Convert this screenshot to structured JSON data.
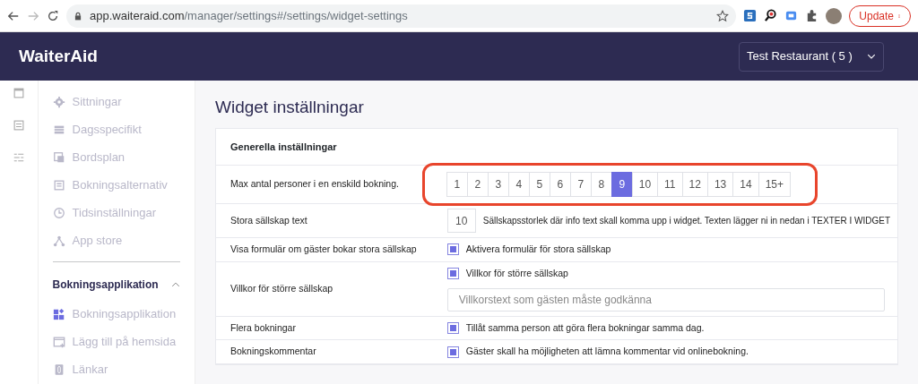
{
  "browser": {
    "url_host": "app.waiteraid.com",
    "url_path": "/manager/settings#/settings/widget-settings",
    "update_label": "Update"
  },
  "header": {
    "logo": "WaiterAid",
    "restaurant": "Test Restaurant ( 5 )"
  },
  "sidebar": {
    "items": [
      {
        "label": "Sittningar",
        "selected": false
      },
      {
        "label": "Dagsspecifikt",
        "selected": false
      },
      {
        "label": "Bordsplan",
        "selected": false
      },
      {
        "label": "Bokningsalternativ",
        "selected": false
      },
      {
        "label": "Tidsinställningar",
        "selected": false
      },
      {
        "label": "App store",
        "selected": false
      }
    ],
    "section": {
      "label": "Bokningsapplikation",
      "expanded": true,
      "items": [
        {
          "label": "Bokningsapplikation",
          "selected": true
        },
        {
          "label": "Lägg till på hemsida",
          "selected": false
        },
        {
          "label": "Länkar",
          "selected": false
        }
      ]
    }
  },
  "page": {
    "title": "Widget inställningar",
    "card_title": "Generella inställningar",
    "rows": [
      {
        "kind": "picker",
        "label": "Max antal personer i en enskild bokning.",
        "options": [
          {
            "label": "1",
            "selected": false
          },
          {
            "label": "2",
            "selected": false
          },
          {
            "label": "3",
            "selected": false
          },
          {
            "label": "4",
            "selected": false
          },
          {
            "label": "5",
            "selected": false
          },
          {
            "label": "6",
            "selected": false
          },
          {
            "label": "7",
            "selected": false
          },
          {
            "label": "8",
            "selected": false
          },
          {
            "label": "9",
            "selected": true
          },
          {
            "label": "10",
            "selected": false
          },
          {
            "label": "11",
            "selected": false
          },
          {
            "label": "12",
            "selected": false
          },
          {
            "label": "13",
            "selected": false
          },
          {
            "label": "14",
            "selected": false
          },
          {
            "label": "15+",
            "selected": false
          }
        ],
        "highlighted": true
      },
      {
        "kind": "number",
        "label": "Stora sällskap text",
        "value": "10",
        "help": "Sällskapsstorlek där info text skall komma upp i widget. Texten lägger ni in nedan i TEXTER I WIDGET"
      },
      {
        "kind": "checkbox",
        "label": "Visa formulär om gäster bokar stora sällskap",
        "checkbox_label": "Aktivera formulär för stora sällskap",
        "checked": true
      },
      {
        "kind": "checkbox",
        "label": "Villkor för större sällskap",
        "checkbox_label": "Villkor för större sällskap",
        "checked": true,
        "placeholder": "Villkorstext som gästen måste godkänna"
      },
      {
        "kind": "checkbox",
        "label": "Flera bokningar",
        "checkbox_label": "Tillåt samma person att göra flera bokningar samma dag.",
        "checked": true
      },
      {
        "kind": "checkbox",
        "label": "Bokningskommentar",
        "checkbox_label": "Gäster skall ha möjligheten att lämna kommentar vid onlinebokning.",
        "checked": true
      }
    ]
  }
}
